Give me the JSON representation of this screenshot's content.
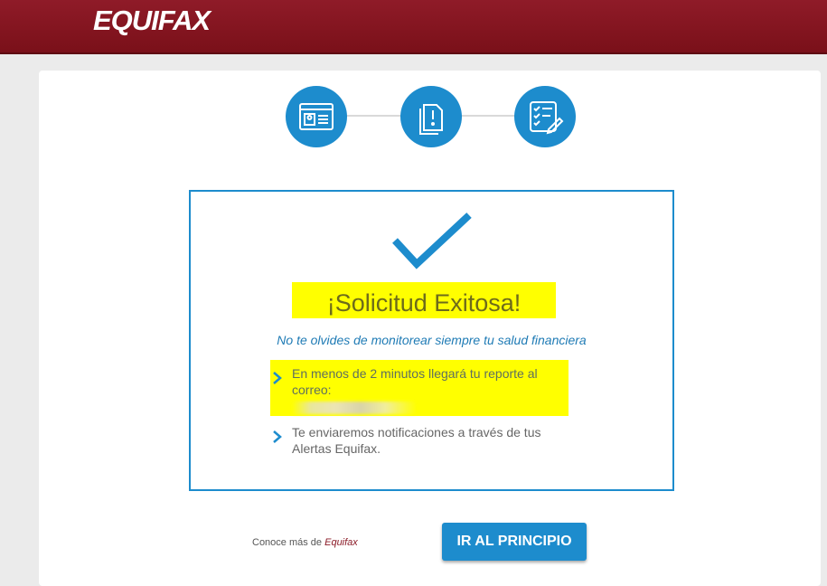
{
  "header": {
    "logo_text": "EQUIFAX",
    "brand_color": "#8b1b27"
  },
  "steps": [
    {
      "icon": "id-card-icon"
    },
    {
      "icon": "document-alert-icon"
    },
    {
      "icon": "checklist-edit-icon"
    }
  ],
  "result": {
    "title": "¡Solicitud Exitosa!",
    "subtitle": "No te olvides de monitorear siempre tu salud financiera",
    "items": [
      {
        "text": "En menos de 2 minutos llegará tu reporte al correo:"
      },
      {
        "text": "Te enviaremos notificaciones a través de tus Alertas Equifax."
      }
    ]
  },
  "footer": {
    "learn_more_prefix": "Conoce más de",
    "learn_more_link": "Equifax",
    "button_label": "IR AL PRINCIPIO"
  },
  "colors": {
    "accent": "#1d8ccd",
    "highlight": "#ffff00"
  }
}
